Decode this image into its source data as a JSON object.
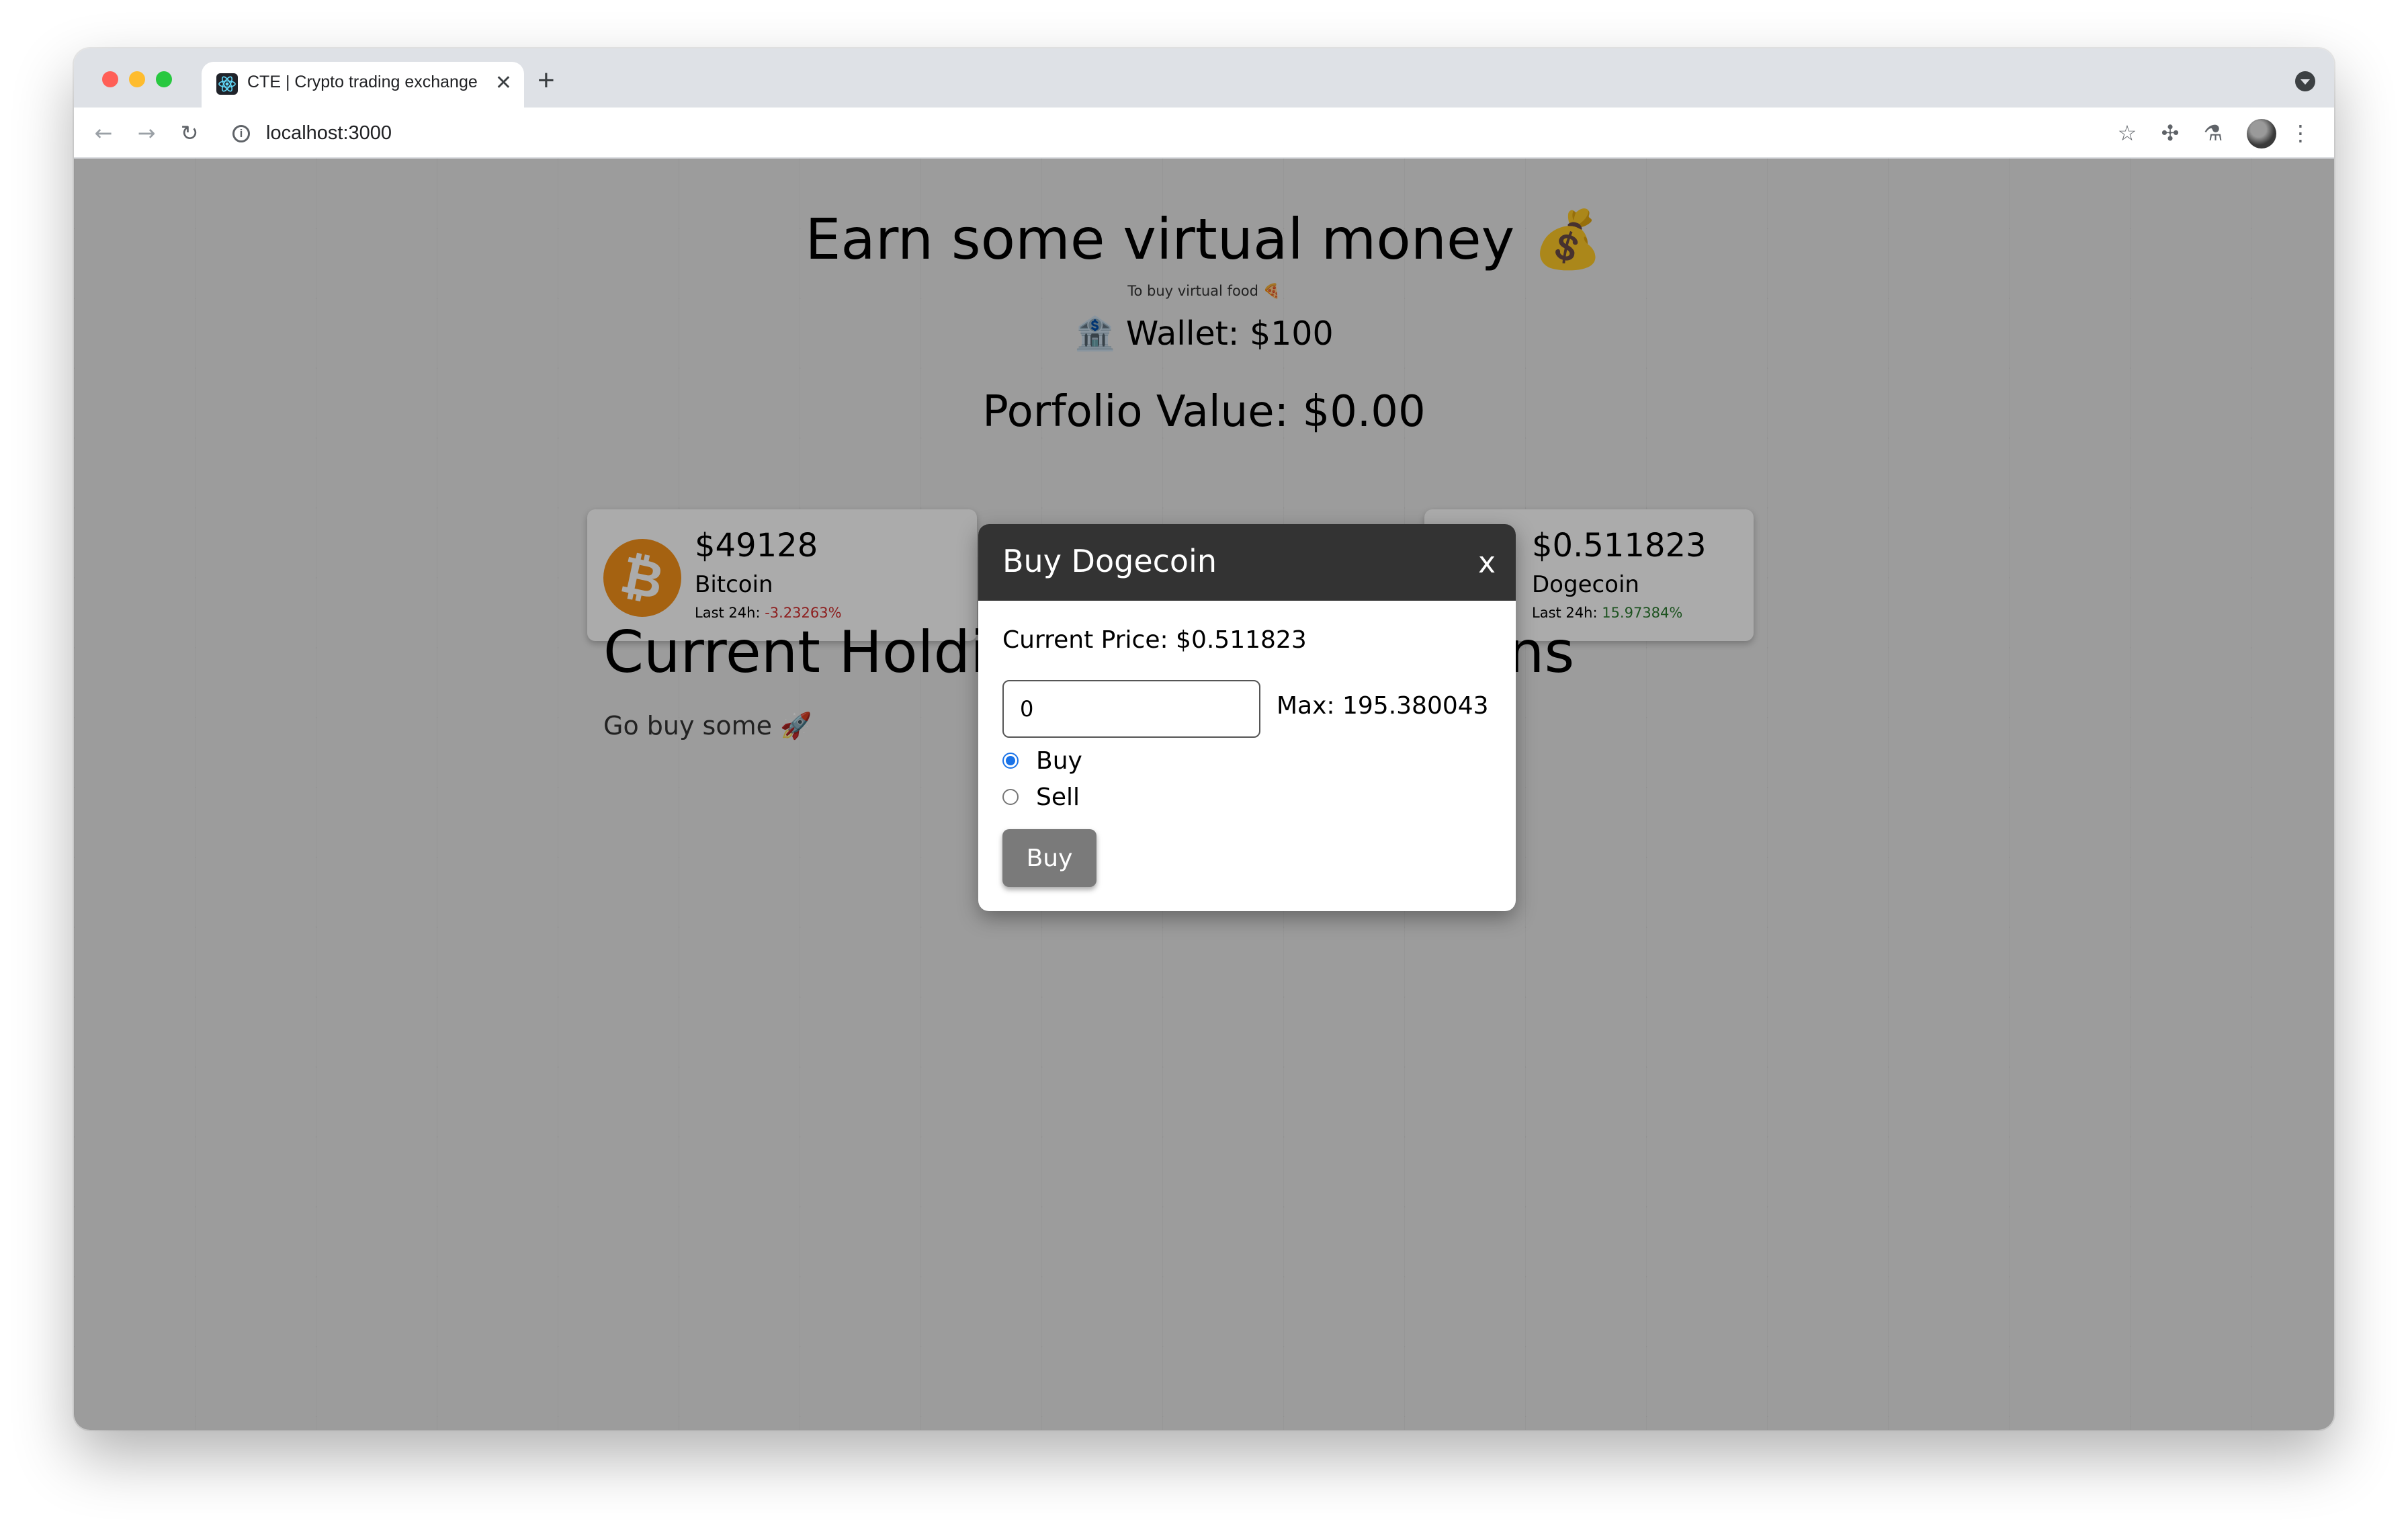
{
  "browser": {
    "tab_title": "CTE | Crypto trading exchange",
    "tab_close": "✕",
    "new_tab": "+",
    "url": "localhost:3000",
    "info": "i"
  },
  "page": {
    "title": "Earn some virtual money 💰",
    "subtitle": "To buy virtual food 🍕",
    "wallet": "🏦 Wallet: $100",
    "portfolio": "Porfolio Value: $0.00",
    "holdings_title_left": "Current Holdir",
    "holdings_title_right": "ns",
    "empty_hint": "Go buy some 🚀"
  },
  "coins": [
    {
      "symbol": "₿",
      "price": "$49128",
      "name": "Bitcoin",
      "change_label": "Last 24h: ",
      "change": "-3.23263%"
    },
    {
      "price": "$0.511823",
      "name": "Dogecoin",
      "change_label": "Last 24h: ",
      "change": "15.97384%"
    }
  ],
  "modal": {
    "title": "Buy Dogecoin",
    "close": "x",
    "current_price": "Current Price: $0.511823",
    "quantity_value": "0",
    "max": "Max: 195.380043",
    "options": [
      "Buy",
      "Sell"
    ],
    "selected": "Buy",
    "submit": "Buy"
  },
  "colors": {
    "negative": "#d32f2f",
    "positive": "#2e7d32",
    "modal_header": "#333333",
    "bitcoin": "#f7931a"
  }
}
